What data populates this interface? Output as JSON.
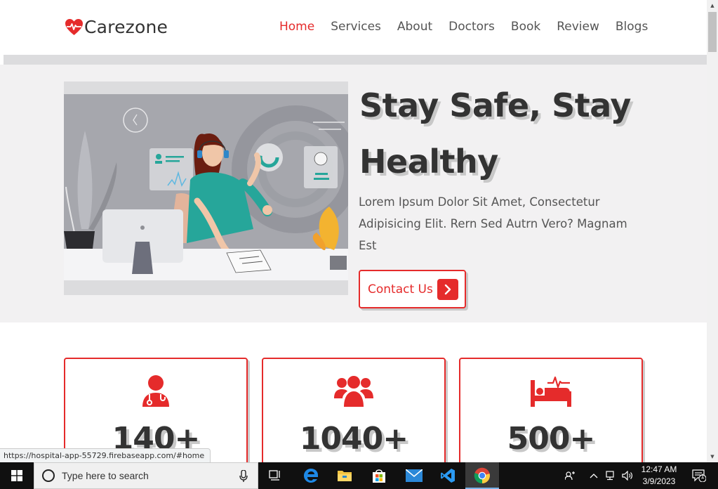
{
  "header": {
    "brand": "Carezone",
    "nav": [
      {
        "label": "Home",
        "active": true
      },
      {
        "label": "Services",
        "active": false
      },
      {
        "label": "About",
        "active": false
      },
      {
        "label": "Doctors",
        "active": false
      },
      {
        "label": "Book",
        "active": false
      },
      {
        "label": "Review",
        "active": false
      },
      {
        "label": "Blogs",
        "active": false
      }
    ]
  },
  "hero": {
    "title_line1": "Stay Safe, Stay",
    "title_line2": "Healthy",
    "text": "Lorem Ipsum Dolor Sit Amet, Consectetur Adipisicing Elit. Rern Sed Autrn Vero? Magnam Est",
    "cta_label": "Contact Us",
    "cta_icon": "chevron-right-icon"
  },
  "stats": [
    {
      "icon": "doctor-icon",
      "value": "140+"
    },
    {
      "icon": "people-icon",
      "value": "1040+"
    },
    {
      "icon": "hospital-bed-icon",
      "value": "500+"
    }
  ],
  "status_bar": {
    "url": "https://hospital-app-55729.firebaseapp.com/#home"
  },
  "taskbar": {
    "search_placeholder": "Type here to search",
    "time": "12:47 AM",
    "date": "3/9/2023",
    "notification_count": "1",
    "apps": [
      "task-view-icon",
      "edge-icon",
      "file-explorer-icon",
      "store-icon",
      "mail-icon",
      "vscode-icon",
      "chrome-icon"
    ]
  },
  "colors": {
    "accent": "#e52b2b",
    "heading": "#333333",
    "hero_bg": "#f2f1f2",
    "teal": "#26a69a"
  }
}
